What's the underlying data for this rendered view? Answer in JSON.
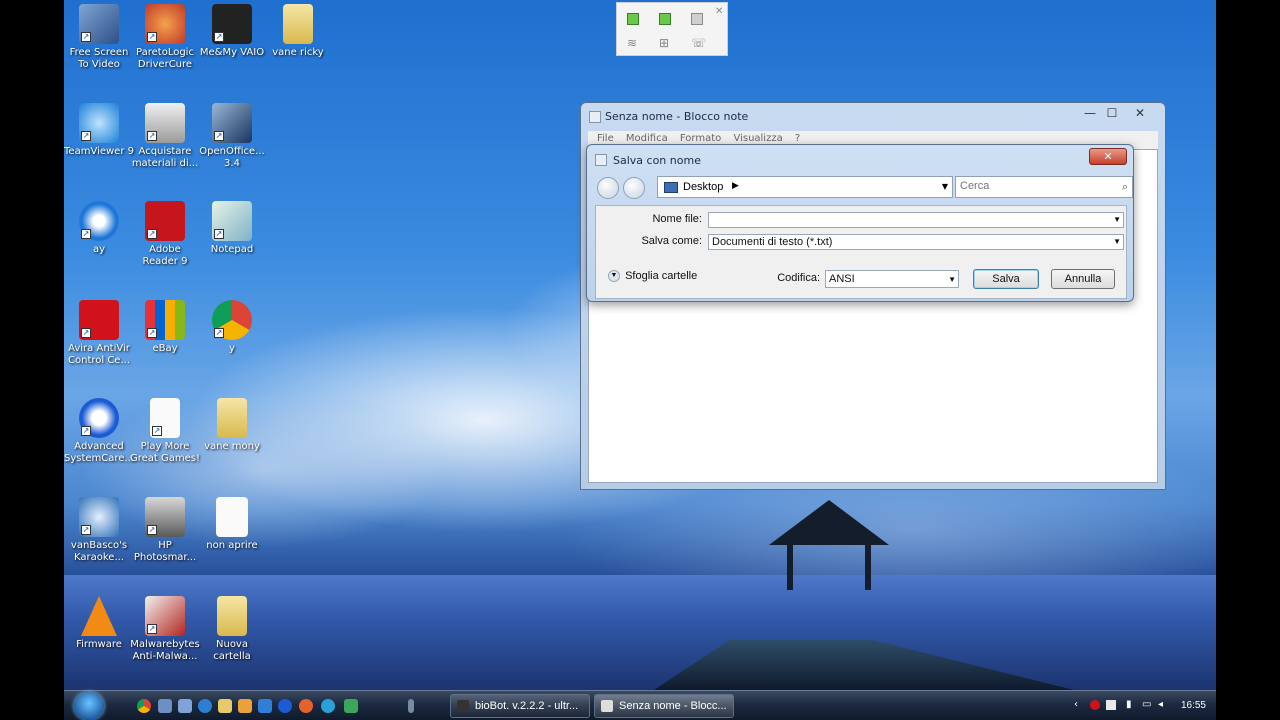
{
  "desktop_icons": [
    {
      "label": "Free Screen To Video"
    },
    {
      "label": "ParetoLogic DriverCure"
    },
    {
      "label": "Me&My VAIO"
    },
    {
      "label": "vane ricky"
    },
    {
      "label": "TeamViewer 9"
    },
    {
      "label": "Acquistare materiali di..."
    },
    {
      "label": "OpenOffice... 3.4"
    },
    {
      "label": "ay"
    },
    {
      "label": "Adobe Reader 9"
    },
    {
      "label": "Notepad"
    },
    {
      "label": "Avira AntiVir Control Ce..."
    },
    {
      "label": "eBay"
    },
    {
      "label": "y"
    },
    {
      "label": "Advanced SystemCare..."
    },
    {
      "label": "Play More Great Games!"
    },
    {
      "label": "vane mony"
    },
    {
      "label": "vanBasco's Karaoke..."
    },
    {
      "label": "HP Photosmar..."
    },
    {
      "label": "non aprire"
    },
    {
      "label": "Firmware"
    },
    {
      "label": "Malwarebytes Anti-Malwa..."
    },
    {
      "label": "Nuova cartella"
    }
  ],
  "notepad": {
    "title": "Senza nome - Blocco note",
    "menu": [
      "File",
      "Modifica",
      "Formato",
      "Visualizza",
      "?"
    ]
  },
  "save_dialog": {
    "title": "Salva con nome",
    "address": "Desktop",
    "search_placeholder": "Cerca",
    "filename_label": "Nome file:",
    "filename_value": "",
    "type_label": "Salva come:",
    "type_value": "Documenti di testo (*.txt)",
    "browse_label": "Sfoglia cartelle",
    "encoding_label": "Codifica:",
    "encoding_value": "ANSI",
    "save_label": "Salva",
    "cancel_label": "Annulla"
  },
  "taskbar": {
    "tasks": [
      {
        "label": "bioBot. v.2.2.2 - ultr..."
      },
      {
        "label": "Senza nome - Blocc..."
      }
    ],
    "clock": "16:55"
  }
}
